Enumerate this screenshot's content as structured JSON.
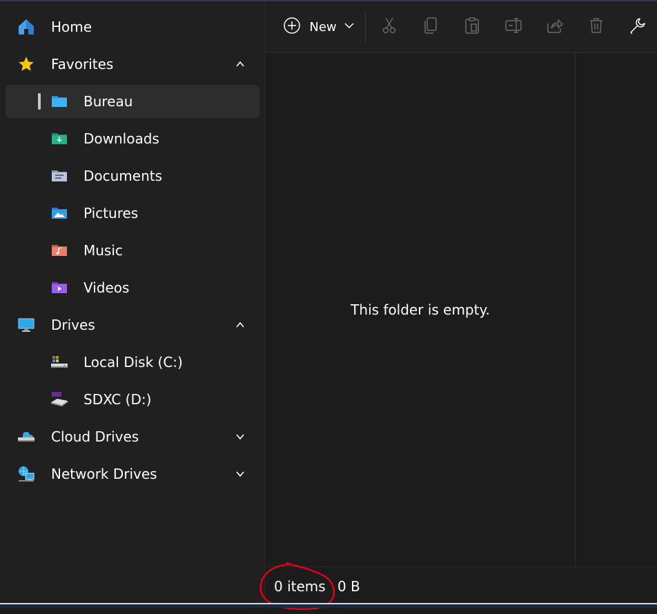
{
  "sidebar": {
    "home": "Home",
    "favorites": "Favorites",
    "favorites_items": {
      "bureau": "Bureau",
      "downloads": "Downloads",
      "documents": "Documents",
      "pictures": "Pictures",
      "music": "Music",
      "videos": "Videos"
    },
    "drives": "Drives",
    "drives_items": {
      "local_disk": "Local Disk (C:)",
      "sdxc": "SDXC (D:)"
    },
    "cloud_drives": "Cloud Drives",
    "network_drives": "Network Drives"
  },
  "toolbar": {
    "new_label": "New",
    "icons": [
      "add-icon",
      "chevron-down-icon",
      "cut-icon",
      "copy-icon",
      "paste-icon",
      "rename-icon",
      "share-icon",
      "delete-icon",
      "properties-icon"
    ]
  },
  "main": {
    "empty_message": "This folder is empty."
  },
  "status": {
    "items": "0 items",
    "size": "0 B"
  },
  "colors": {
    "sidebar_bg": "#202020",
    "main_bg": "#1c1c1c",
    "selected_bg": "#2d2d2d",
    "annotation": "#e0001b"
  }
}
